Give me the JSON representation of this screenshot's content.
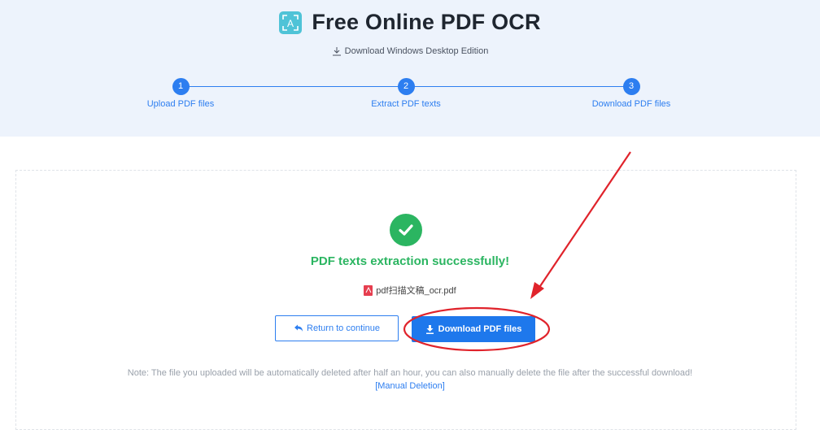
{
  "header": {
    "title": "Free Online PDF OCR",
    "logo_icon": "ocr-logo-icon",
    "desktop_link": "Download Windows Desktop Edition"
  },
  "steps": [
    {
      "number": "1",
      "label": "Upload PDF files"
    },
    {
      "number": "2",
      "label": "Extract PDF texts"
    },
    {
      "number": "3",
      "label": "Download PDF files"
    }
  ],
  "result": {
    "success_message": "PDF texts extraction successfully!",
    "file_name": "pdf扫描文稿_ocr.pdf",
    "return_label": "Return to continue",
    "download_label": "Download PDF files",
    "note": "Note: The file you uploaded will be automatically deleted after half an hour, you can also manually delete the file after the successful download!",
    "manual_deletion": "[Manual Deletion]"
  },
  "colors": {
    "accent": "#2d7ef0",
    "success": "#2bb561",
    "annotation": "#e0232b"
  }
}
